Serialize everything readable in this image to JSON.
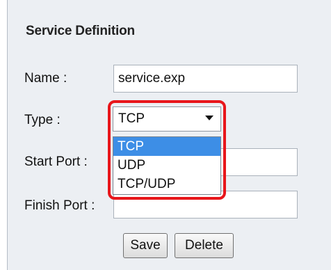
{
  "form": {
    "title": "Service Definition",
    "name_label": "Name :",
    "name_value": "service.exp",
    "type_label": "Type :",
    "type_selected": "TCP",
    "type_options": [
      "TCP",
      "UDP",
      "TCP/UDP"
    ],
    "start_port_label": "Start Port :",
    "start_port_value": "",
    "finish_port_label": "Finish Port :",
    "finish_port_value": ""
  },
  "buttons": {
    "save": "Save",
    "delete": "Delete"
  },
  "colors": {
    "panel_bg": "#eceff3",
    "selected_option": "#3d8ee6",
    "highlight_border": "#e8161b"
  }
}
